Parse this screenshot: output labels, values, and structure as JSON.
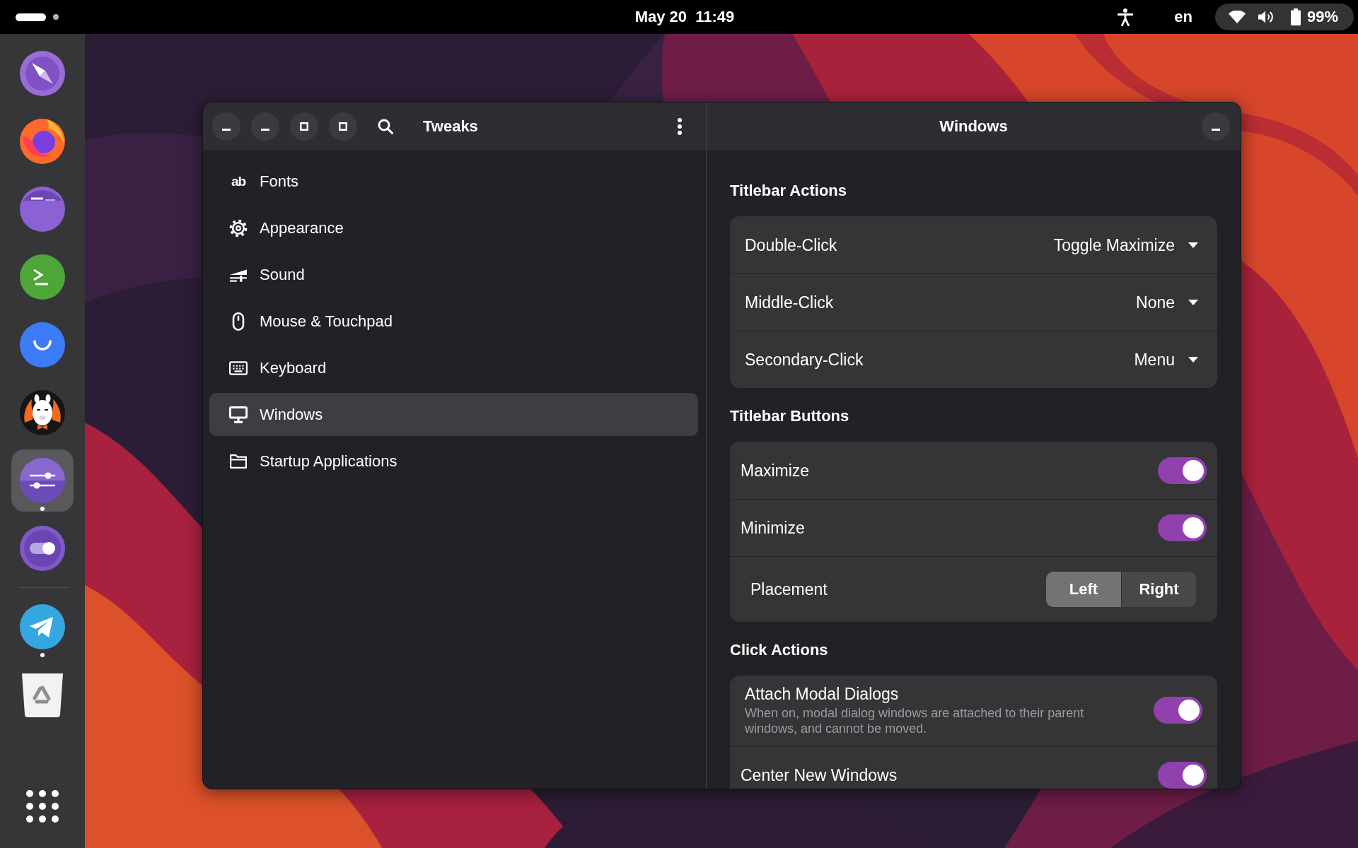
{
  "top_bar": {
    "workspaces": [
      {
        "selected": true
      },
      {
        "selected": false
      }
    ],
    "clock": "May 20  11:49",
    "input_source": "en",
    "battery": "99%"
  },
  "dock": {
    "favorites": [
      {
        "running": false,
        "selected": false
      },
      {
        "running": false,
        "selected": false
      },
      {
        "running": false,
        "selected": false
      },
      {
        "running": false,
        "selected": false
      },
      {
        "running": false,
        "selected": false
      },
      {
        "running": false,
        "selected": false
      },
      {
        "running": true,
        "selected": true
      },
      {
        "running": false,
        "selected": false
      }
    ],
    "others": [
      {
        "running": true,
        "selected": false
      },
      {
        "running": false,
        "selected": false
      }
    ]
  },
  "window": {
    "title": "Tweaks",
    "buttons": [
      {
        "kind": "minimize"
      },
      {
        "kind": "minimize"
      },
      {
        "kind": "maximize"
      },
      {
        "kind": "maximize"
      }
    ],
    "sidebar": {
      "items": [
        {
          "label": "Fonts",
          "icon_text": "ab",
          "selected": false
        },
        {
          "label": "Appearance",
          "selected": false
        },
        {
          "label": "Sound",
          "selected": false
        },
        {
          "label": "Mouse & Touchpad",
          "selected": false
        },
        {
          "label": "Keyboard",
          "selected": false
        },
        {
          "label": "Windows",
          "selected": true
        },
        {
          "label": "Startup Applications",
          "selected": false
        }
      ]
    },
    "page": {
      "title": "Windows",
      "buttons": [
        {
          "kind": "minimize"
        }
      ],
      "sections": [
        {
          "title": "Titlebar Actions",
          "rows": [
            {
              "kind": "dropdown",
              "label": "Double-Click",
              "value": "Toggle Maximize"
            },
            {
              "kind": "dropdown",
              "label": "Middle-Click",
              "value": "None"
            },
            {
              "kind": "dropdown",
              "label": "Secondary-Click",
              "value": "Menu"
            }
          ]
        },
        {
          "title": "Titlebar Buttons",
          "rows": [
            {
              "kind": "switch",
              "label": "Maximize",
              "on": true
            },
            {
              "kind": "switch",
              "label": "Minimize",
              "on": true
            },
            {
              "kind": "segmented",
              "label": "Placement",
              "options": [
                {
                  "label": "Left",
                  "selected": true
                },
                {
                  "label": "Right",
                  "selected": false
                }
              ]
            }
          ]
        },
        {
          "title": "Click Actions",
          "rows": [
            {
              "kind": "switch",
              "label": "Attach Modal Dialogs",
              "description": "When on, modal dialog windows are attached to their parent windows, and cannot be moved.",
              "on": true
            },
            {
              "kind": "switch",
              "label": "Center New Windows",
              "on": true
            }
          ]
        }
      ]
    }
  }
}
